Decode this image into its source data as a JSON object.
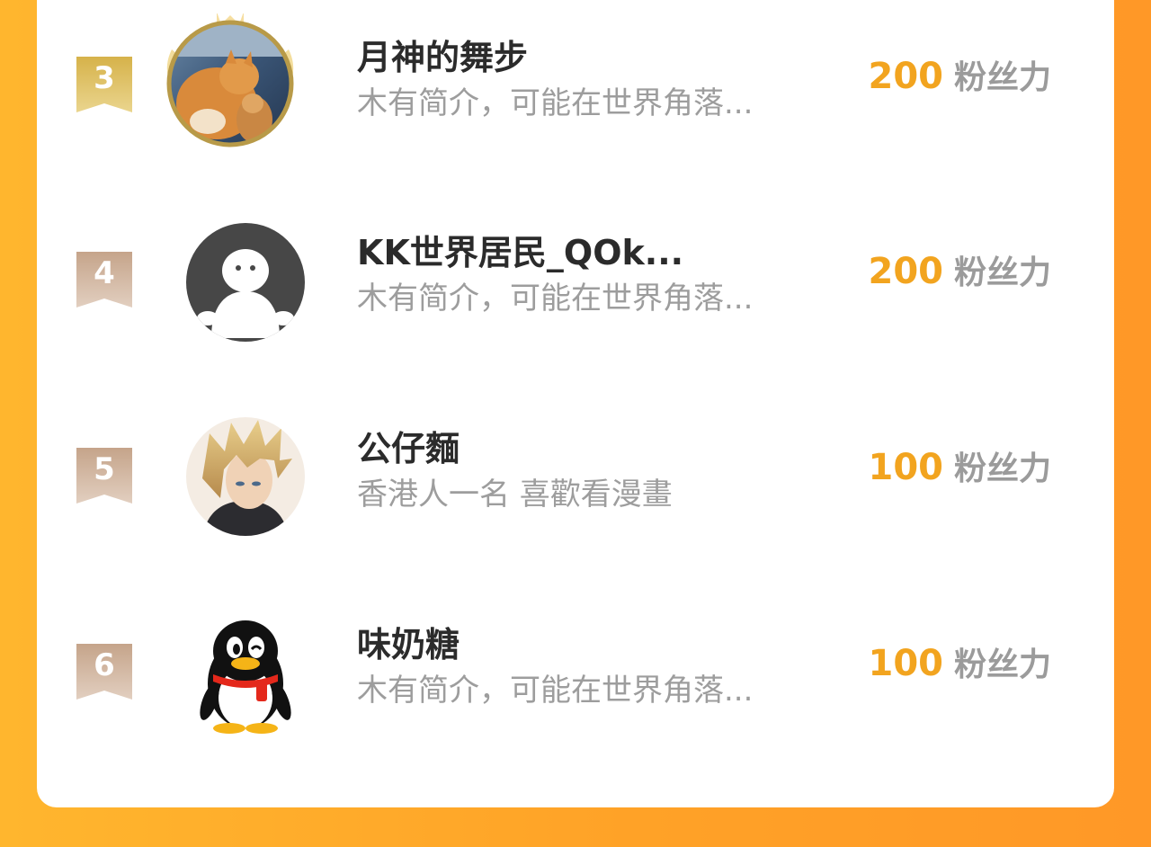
{
  "colors": {
    "background": "#ffa227",
    "card": "#ffffff",
    "score": "#f2a41f",
    "name": "#2b2b2b",
    "bio": "#9d9d9d",
    "unit": "#9b9b9b",
    "gold_badge": "#c9a441",
    "bronze_badge": "#c8ad98"
  },
  "rows": [
    {
      "rank": "3",
      "name": "月神的舞步",
      "bio": "木有简介，可能在世界角落...",
      "score": "200",
      "unit": "粉丝力",
      "badge_style": "gold",
      "avatar_icon": "cat-photo-avatar-icon"
    },
    {
      "rank": "4",
      "name": "KK世界居民_QOk...",
      "bio": "木有简介，可能在世界角落...",
      "score": "200",
      "unit": "粉丝力",
      "badge_style": "bronze",
      "avatar_icon": "default-user-avatar-icon"
    },
    {
      "rank": "5",
      "name": "公仔麵",
      "bio": "香港人一名 喜歡看漫畫",
      "score": "100",
      "unit": "粉丝力",
      "badge_style": "bronze",
      "avatar_icon": "anime-character-avatar-icon"
    },
    {
      "rank": "6",
      "name": "味奶糖",
      "bio": "木有简介，可能在世界角落...",
      "score": "100",
      "unit": "粉丝力",
      "badge_style": "bronze",
      "avatar_icon": "penguin-avatar-icon"
    }
  ]
}
